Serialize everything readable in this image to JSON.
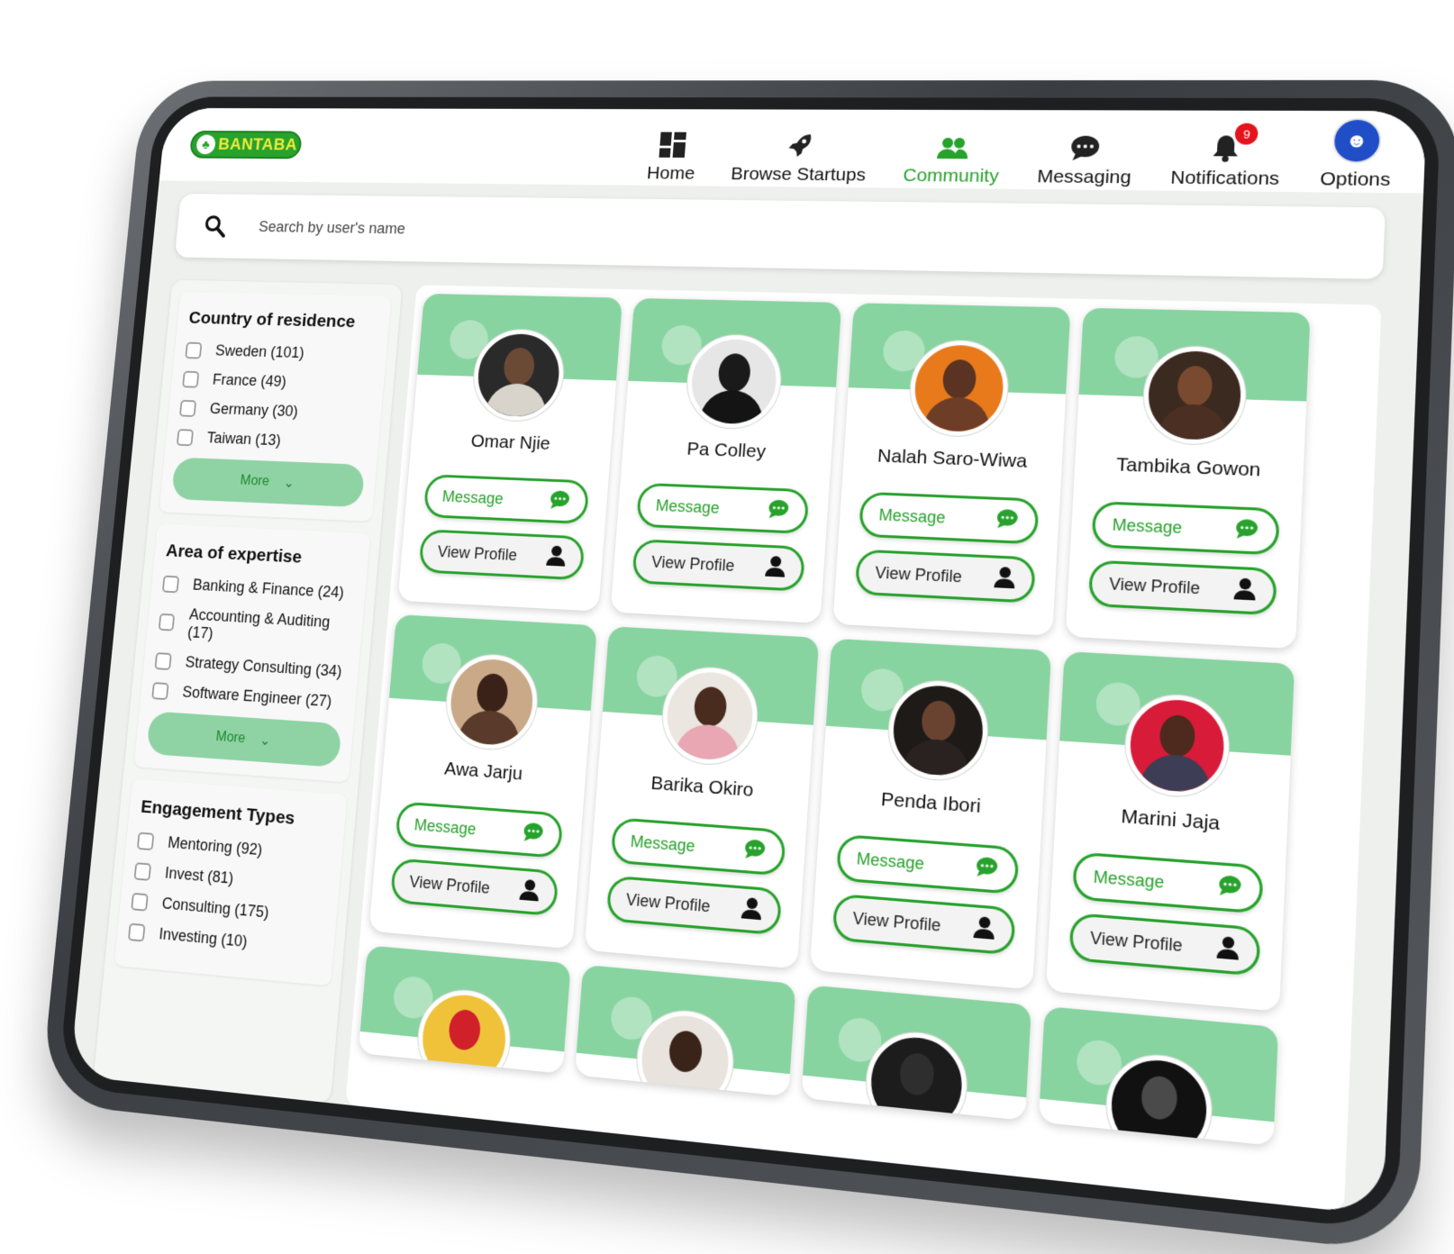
{
  "app": {
    "logo_text": "BANTABA"
  },
  "nav": {
    "items": [
      {
        "label": "Home",
        "icon": "grid-icon"
      },
      {
        "label": "Browse Startups",
        "icon": "rocket-icon"
      },
      {
        "label": "Community",
        "icon": "people-icon",
        "active": true
      },
      {
        "label": "Messaging",
        "icon": "chat-icon"
      },
      {
        "label": "Notifications",
        "icon": "bell-icon",
        "badge": "9"
      },
      {
        "label": "Options",
        "icon": "user-avatar-icon"
      }
    ]
  },
  "search": {
    "placeholder": "Search by user's name"
  },
  "filters": [
    {
      "title": "Country of residence",
      "options": [
        "Sweden (101)",
        "France (49)",
        "Germany (30)",
        "Taiwan (13)"
      ],
      "more": "More"
    },
    {
      "title": "Area of expertise",
      "options": [
        "Banking & Finance (24)",
        "Accounting & Auditing (17)",
        "Strategy Consulting (34)",
        "Software Engineer (27)"
      ],
      "more": "More"
    },
    {
      "title": "Engagement Types",
      "options": [
        "Mentoring (92)",
        "Invest (81)",
        "Consulting (175)",
        "Investing (10)"
      ],
      "more": ""
    }
  ],
  "cards": [
    {
      "name": "Omar Njie",
      "message": "Message",
      "view": "View Profile"
    },
    {
      "name": "Pa Colley",
      "message": "Message",
      "view": "View Profile"
    },
    {
      "name": "Nalah Saro-Wiwa",
      "message": "Message",
      "view": "View Profile"
    },
    {
      "name": "Tambika Gowon",
      "message": "Message",
      "view": "View Profile"
    },
    {
      "name": "Awa Jarju",
      "message": "Message",
      "view": "View Profile"
    },
    {
      "name": "Barika Okiro",
      "message": "Message",
      "view": "View Profile"
    },
    {
      "name": "Penda Ibori",
      "message": "Message",
      "view": "View Profile"
    },
    {
      "name": "Marini Jaja",
      "message": "Message",
      "view": "View Profile"
    }
  ],
  "colors": {
    "accent": "#27a22c",
    "banner": "#87d4a0",
    "badge": "#e3141b"
  }
}
